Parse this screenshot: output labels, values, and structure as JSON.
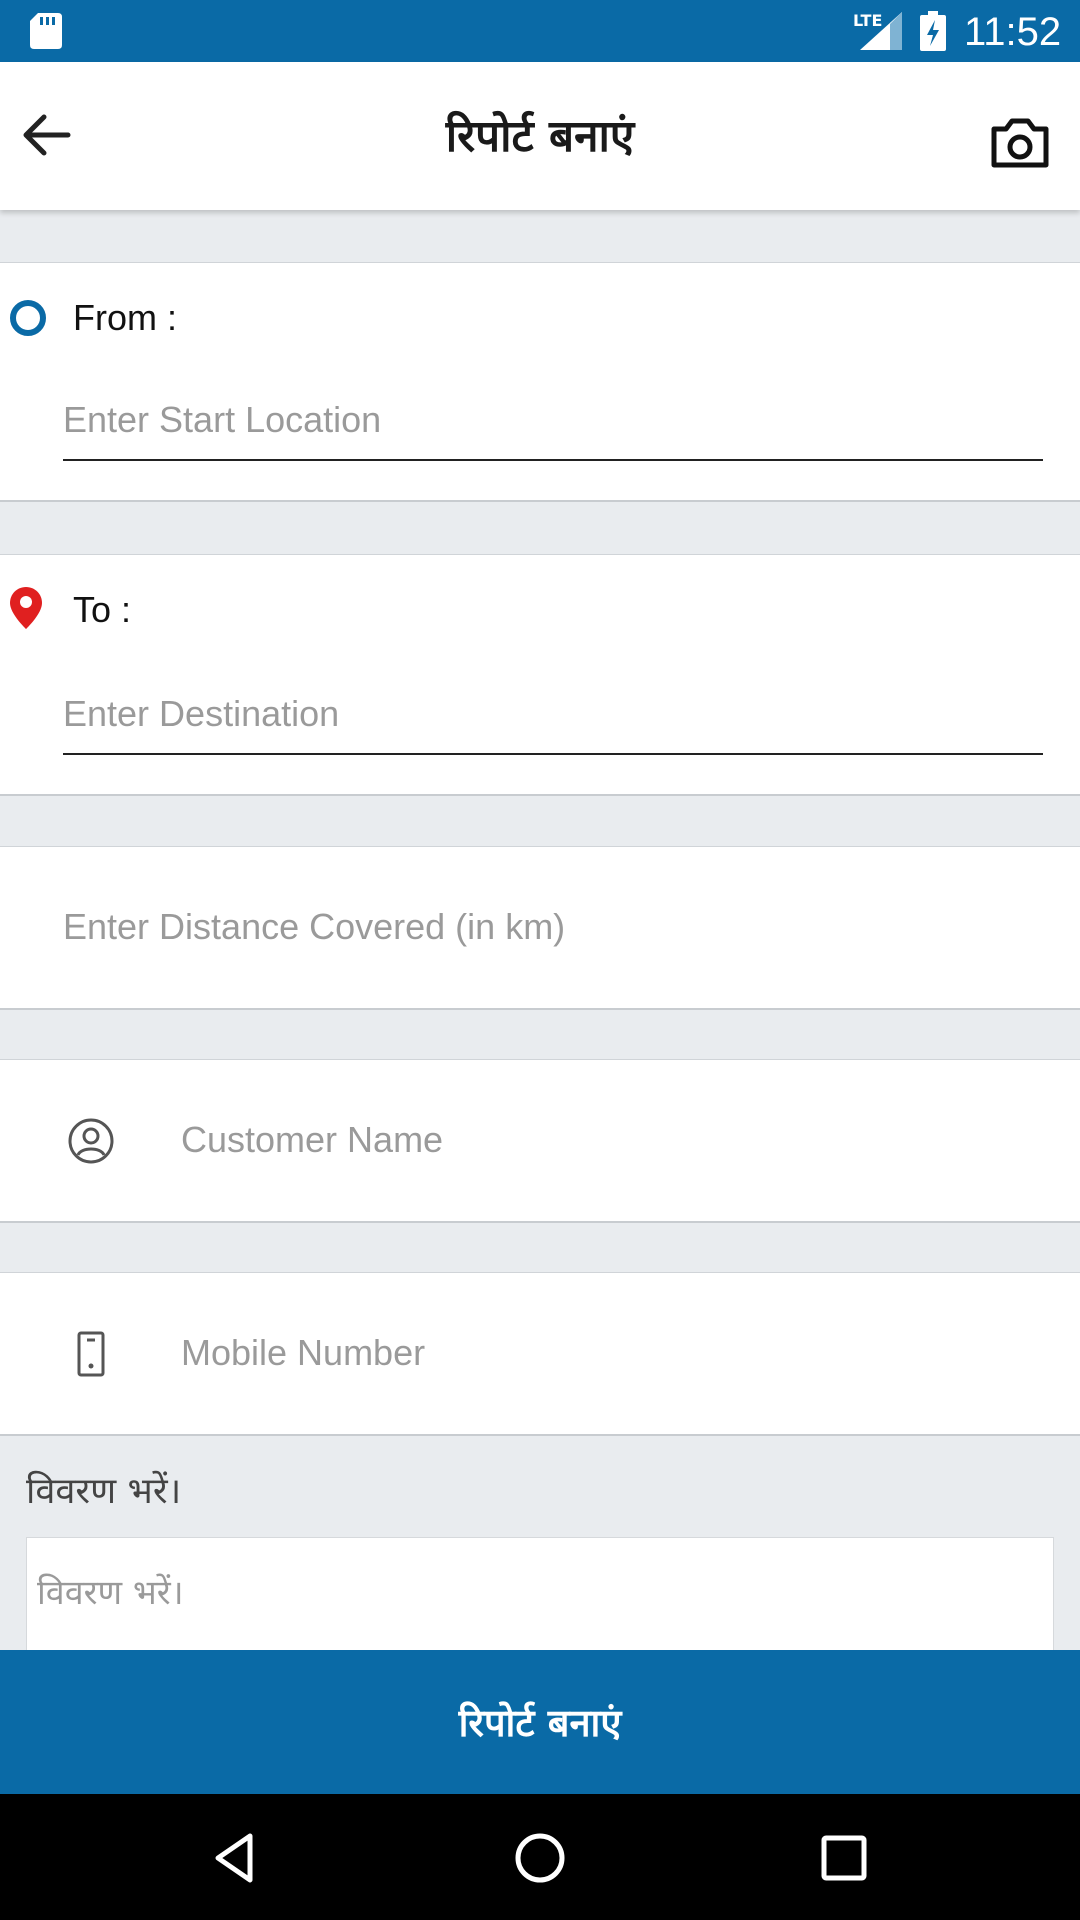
{
  "status_bar": {
    "time": "11:52",
    "network": "LTE",
    "icons": [
      "sd-card-icon",
      "signal-icon",
      "battery-charging-icon"
    ]
  },
  "app_bar": {
    "title": "रिपोर्ट बनाएं",
    "icons": [
      "back-arrow-icon",
      "camera-icon"
    ]
  },
  "route": {
    "from_label": "From :",
    "from_placeholder": "Enter Start Location",
    "from_value": "",
    "to_label": "To :",
    "to_placeholder": "Enter Destination",
    "to_value": ""
  },
  "distance": {
    "placeholder": "Enter Distance Covered (in km)",
    "value": ""
  },
  "customer": {
    "name_placeholder": "Customer Name",
    "mobile_placeholder": "Mobile Number",
    "icons": [
      "person-circle-icon",
      "mobile-phone-icon"
    ]
  },
  "description": {
    "label": "विवरण भरें।",
    "placeholder": "विवरण भरें।",
    "value": ""
  },
  "submit_label": "रिपोर्ट बनाएं",
  "nav_bar": {
    "icons": [
      "nav-back-icon",
      "nav-home-icon",
      "nav-recents-icon"
    ]
  },
  "colors": {
    "primary": "#0a6aa6",
    "pin": "#e02020",
    "background": "#e9ecef"
  }
}
